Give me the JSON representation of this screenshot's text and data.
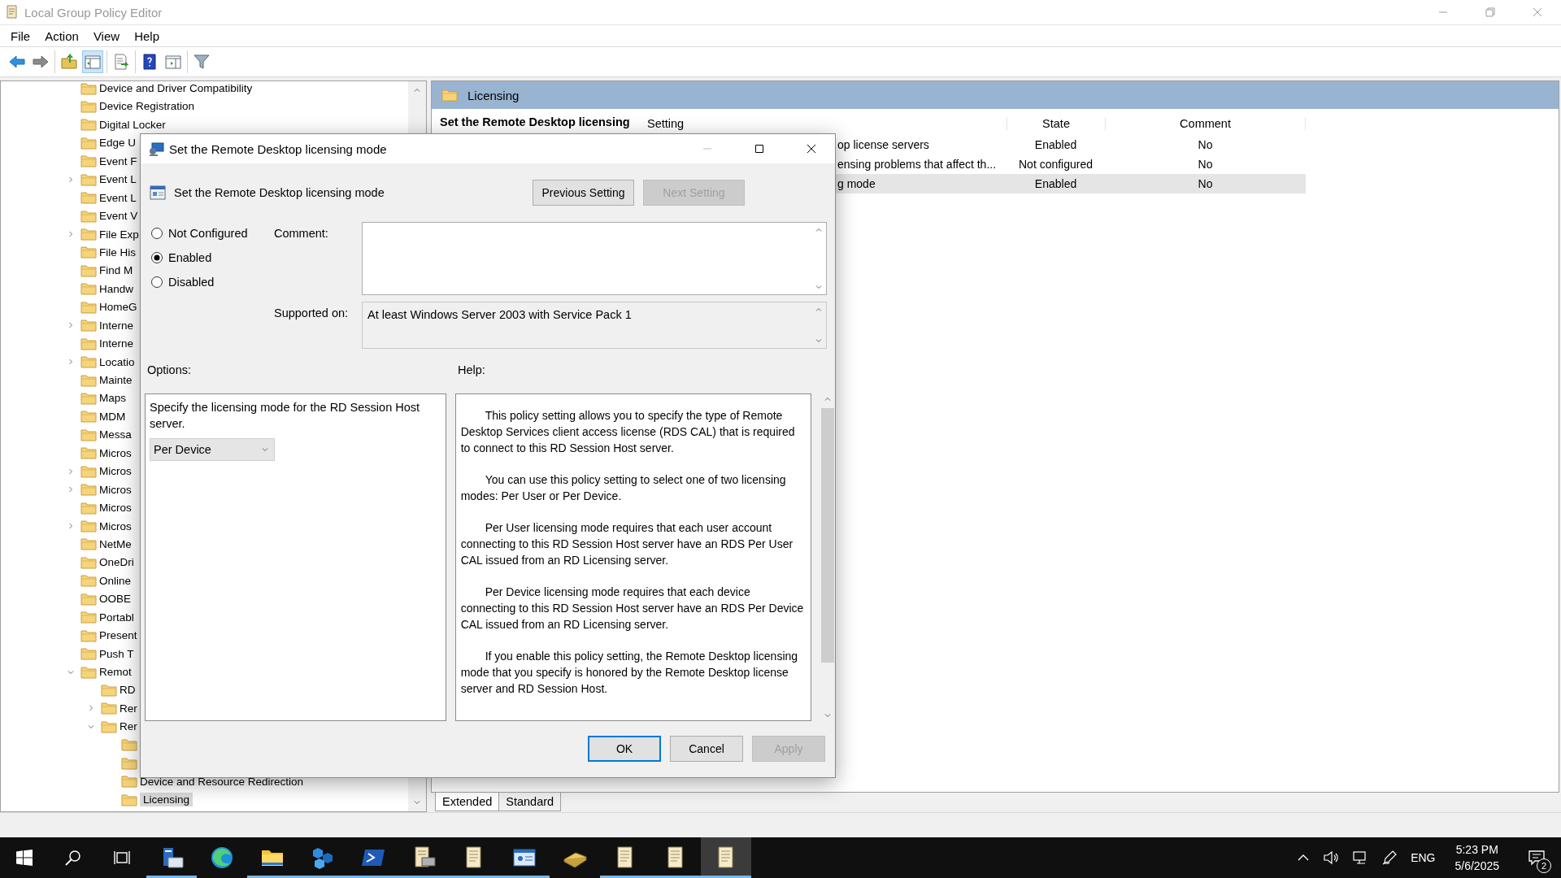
{
  "window": {
    "title": "Local Group Policy Editor"
  },
  "menu": [
    "File",
    "Action",
    "View",
    "Help"
  ],
  "toolbar_groups": [
    {
      "buttons": [
        {
          "pressed": false
        },
        {
          "pressed": false
        }
      ]
    },
    {
      "buttons": [
        {
          "pressed": false
        },
        {
          "pressed": true
        }
      ]
    },
    {
      "buttons": [
        {
          "pressed": false
        }
      ]
    },
    {
      "buttons": [
        {
          "pressed": false
        },
        {
          "pressed": false
        }
      ]
    },
    {
      "buttons": [
        {
          "pressed": false
        }
      ]
    }
  ],
  "tree": {
    "items": [
      {
        "label": "Device and Driver Compatibility",
        "selected": false
      },
      {
        "label": "Device Registration",
        "selected": false
      },
      {
        "label": "Digital Locker",
        "selected": false
      },
      {
        "label": "Edge U",
        "selected": false
      },
      {
        "label": "Event F",
        "selected": false
      },
      {
        "label": "Event L",
        "expanded": false,
        "selected": false
      },
      {
        "label": "Event L",
        "selected": false
      },
      {
        "label": "Event V",
        "selected": false
      },
      {
        "label": "File Exp",
        "expanded": false,
        "selected": false
      },
      {
        "label": "File His",
        "selected": false
      },
      {
        "label": "Find M",
        "selected": false
      },
      {
        "label": "Handw",
        "selected": false
      },
      {
        "label": "HomeG",
        "selected": false
      },
      {
        "label": "Interne",
        "expanded": false,
        "selected": false
      },
      {
        "label": "Interne",
        "selected": false
      },
      {
        "label": "Locatio",
        "expanded": false,
        "selected": false
      },
      {
        "label": "Mainte",
        "selected": false
      },
      {
        "label": "Maps",
        "selected": false
      },
      {
        "label": "MDM",
        "selected": false
      },
      {
        "label": "Messa",
        "selected": false
      },
      {
        "label": "Micros",
        "selected": false
      },
      {
        "label": "Micros",
        "expanded": false,
        "selected": false
      },
      {
        "label": "Micros",
        "expanded": false,
        "selected": false
      },
      {
        "label": "Micros",
        "selected": false
      },
      {
        "label": "Micros",
        "expanded": false,
        "selected": false
      },
      {
        "label": "NetMe",
        "selected": false
      },
      {
        "label": "OneDri",
        "selected": false
      },
      {
        "label": "Online",
        "selected": false
      },
      {
        "label": "OOBE",
        "selected": false
      },
      {
        "label": "Portabl",
        "selected": false
      },
      {
        "label": "Present",
        "selected": false
      },
      {
        "label": "Push T",
        "selected": false
      },
      {
        "label": "Remot",
        "expanded": true,
        "selected": false,
        "children": [
          {
            "label": "RD",
            "selected": false
          },
          {
            "label": "Rer",
            "expanded": false,
            "selected": false
          },
          {
            "label": "Rer",
            "expanded": true,
            "selected": false,
            "children": [
              {
                "selected": false
              },
              {
                "selected": false
              },
              {
                "label": "Device and Resource Redirection",
                "selected": false
              },
              {
                "label": "Licensing",
                "selected": true
              }
            ]
          }
        ]
      }
    ]
  },
  "details": {
    "header": "Licensing",
    "description_title": "Set the Remote Desktop licensing",
    "columns": [
      "Setting",
      "State",
      "Comment"
    ],
    "rows": [
      {
        "setting": "op license servers",
        "state": "Enabled",
        "comment": "No",
        "selected": false
      },
      {
        "setting": "ensing problems that affect th...",
        "state": "Not configured",
        "comment": "No",
        "selected": false
      },
      {
        "setting": "g mode",
        "state": "Enabled",
        "comment": "No",
        "selected": true
      }
    ]
  },
  "view_tabs": [
    {
      "label": "Extended",
      "selected": true
    },
    {
      "label": "Standard",
      "selected": false
    }
  ],
  "dialog": {
    "title": "Set the Remote Desktop licensing mode",
    "policy_name": "Set the Remote Desktop licensing mode",
    "nav_buttons": [
      {
        "label": "Previous Setting",
        "disabled": false
      },
      {
        "label": "Next Setting",
        "disabled": true
      }
    ],
    "radios": [
      {
        "label": "Not Configured",
        "selected": false
      },
      {
        "label": "Enabled",
        "selected": true
      },
      {
        "label": "Disabled",
        "selected": false
      }
    ],
    "comment_label": "Comment:",
    "supported_label": "Supported on:",
    "supported_value": "At least Windows Server 2003 with Service Pack 1",
    "options_label": "Options:",
    "help_label": "Help:",
    "options_text": "Specify the licensing mode for the RD Session Host server.",
    "options_dropdown": "Per Device",
    "help_paragraphs": [
      "This policy setting allows you to specify the type of Remote Desktop Services client access license (RDS CAL) that is required to connect to this RD Session Host server.",
      "You can use this policy setting to select one of two licensing modes: Per User or Per Device.",
      "Per User licensing mode requires that each user account connecting to this RD Session Host server have an RDS Per User CAL issued from an RD Licensing server.",
      "Per Device licensing mode requires that each device connecting to this RD Session Host server have an RDS Per Device CAL issued from an RD Licensing server.",
      "If you enable this policy setting, the Remote Desktop licensing mode that you specify is honored by the Remote Desktop license server and RD Session Host."
    ],
    "buttons": [
      {
        "label": "OK",
        "default": true,
        "disabled": false
      },
      {
        "label": "Cancel",
        "default": false,
        "disabled": false
      },
      {
        "label": "Apply",
        "default": false,
        "disabled": true
      }
    ]
  },
  "taskbar": {
    "apps": [
      {
        "kind": "server",
        "running": true,
        "selected": false
      },
      {
        "kind": "browser",
        "running": false,
        "selected": false
      },
      {
        "kind": "folder",
        "running": true,
        "selected": false
      },
      {
        "kind": "cubes",
        "running": true,
        "selected": false
      },
      {
        "kind": "terminal",
        "running": true,
        "selected": false
      },
      {
        "kind": "scroll-printer",
        "running": true,
        "selected": false
      },
      {
        "kind": "scroll",
        "running": true,
        "selected": false
      },
      {
        "kind": "window-card",
        "running": true,
        "selected": false
      },
      {
        "kind": "book",
        "running": false,
        "selected": false
      },
      {
        "kind": "scroll",
        "running": true,
        "selected": false
      },
      {
        "kind": "scroll",
        "running": true,
        "selected": false
      },
      {
        "kind": "scroll",
        "running": true,
        "selected": true
      }
    ],
    "language": "ENG",
    "time": "5:23 PM",
    "date": "5/6/2025",
    "notifications": "2"
  }
}
